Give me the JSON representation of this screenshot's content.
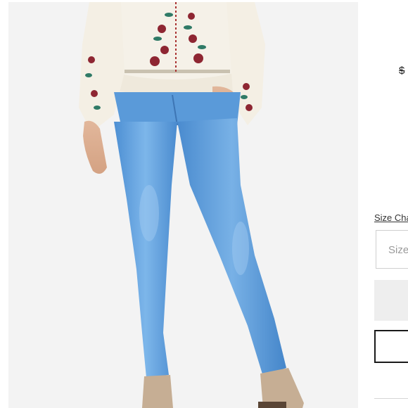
{
  "product": {
    "image_alt": "Woman wearing light blue skinny jeans with an embroidered white blouse and tan ankle boots",
    "price_text": "$",
    "size_chart_label": "Size Chart",
    "size_select_placeholder": "Size"
  },
  "colors": {
    "denim": "#5ea0dc",
    "blouse": "#f4f0e6",
    "boot": "#c8b39a",
    "background": "#f3f3f3"
  }
}
